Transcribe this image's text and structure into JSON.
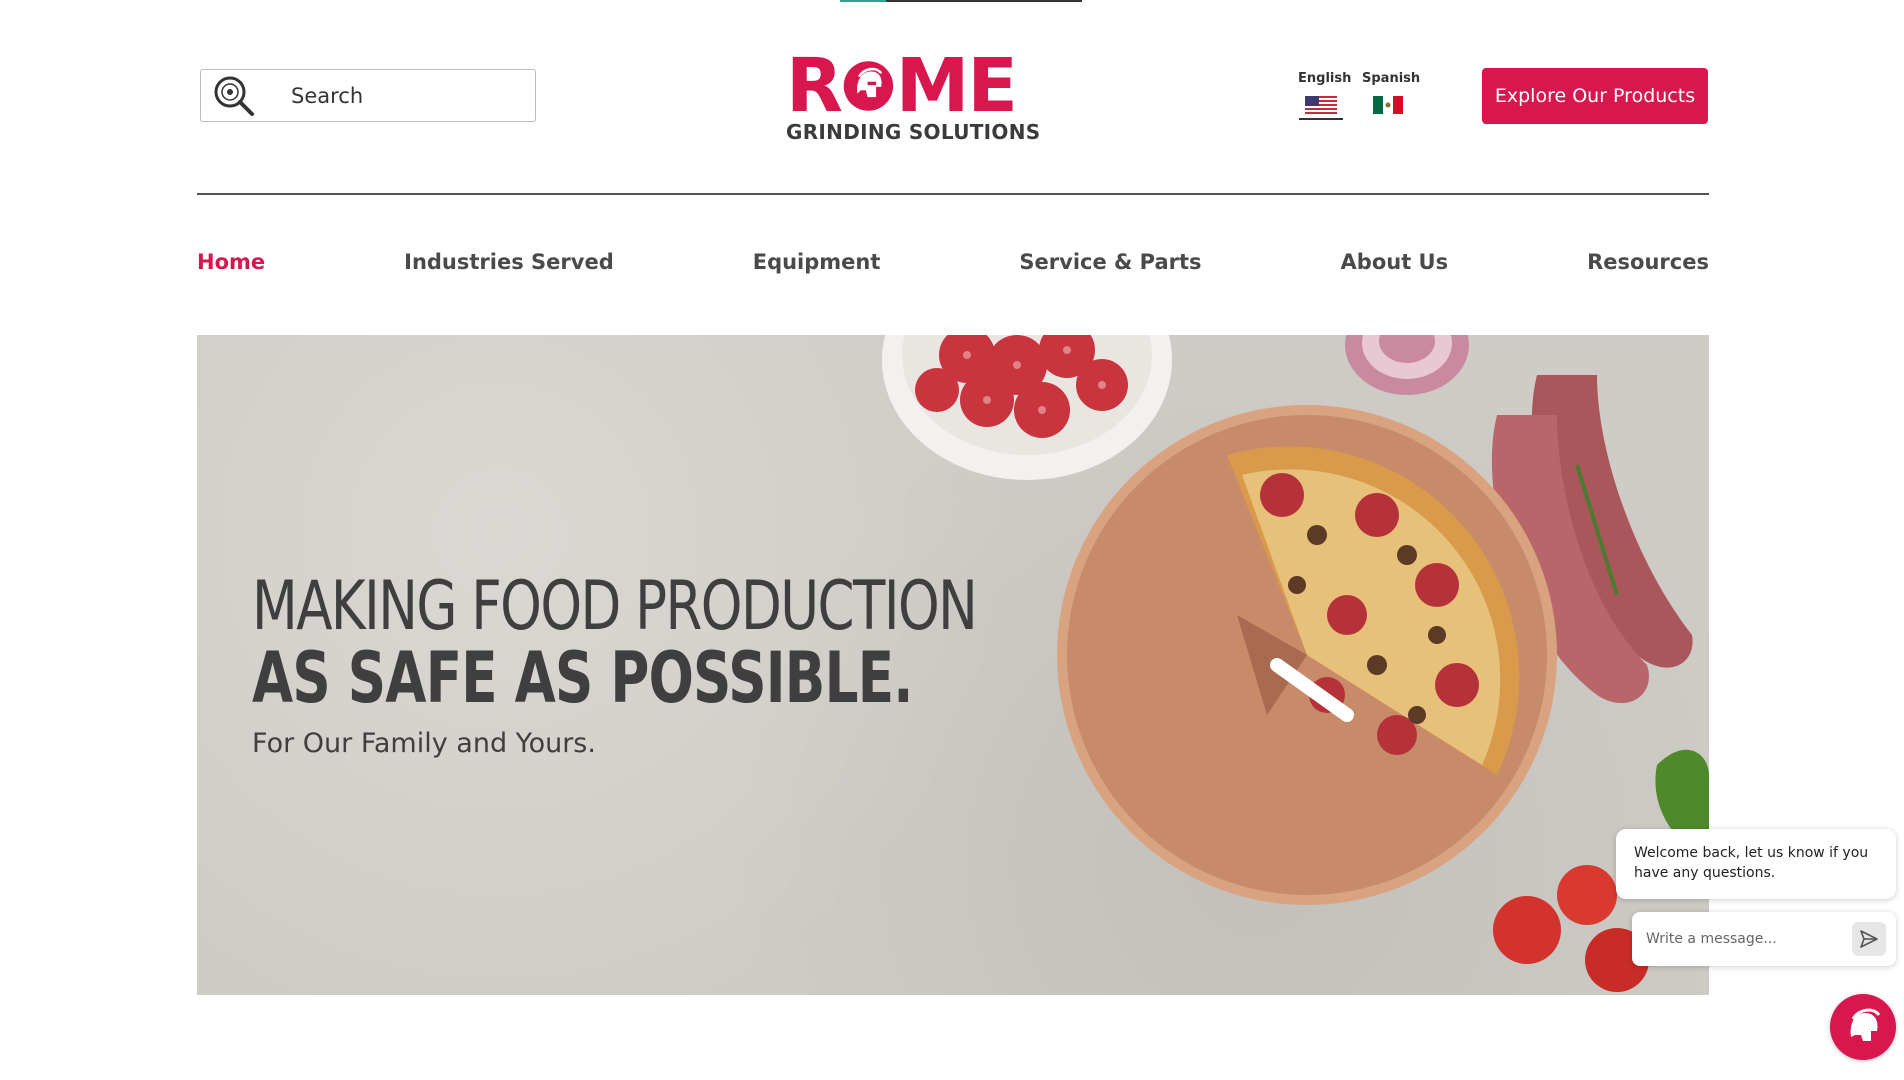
{
  "header": {
    "search_placeholder": "Search",
    "logo": {
      "brand": "ROME",
      "subtitle": "GRINDING SOLUTIONS"
    },
    "languages": [
      {
        "label": "English",
        "flag_icon": "us-flag-icon",
        "active": true
      },
      {
        "label": "Spanish",
        "flag_icon": "mexico-flag-icon",
        "active": false
      }
    ],
    "cta_label": "Explore Our Products"
  },
  "nav": {
    "items": [
      {
        "label": "Home",
        "active": true
      },
      {
        "label": "Industries Served"
      },
      {
        "label": "Equipment"
      },
      {
        "label": "Service & Parts"
      },
      {
        "label": "About Us"
      },
      {
        "label": "Resources"
      }
    ]
  },
  "hero": {
    "headline_line1": "MAKING FOOD PRODUCTION",
    "headline_line2": "AS SAFE AS POSSIBLE.",
    "tagline": "For Our Family and Yours."
  },
  "chat": {
    "message": "Welcome back, let us know if you have any questions.",
    "input_placeholder": "Write a message...",
    "send_icon": "send-icon",
    "launcher_icon": "spartan-helmet-icon"
  },
  "colors": {
    "brand_red": "#d8174f",
    "text_dark": "#3f3f3f",
    "hero_bg": "#cfcbc6"
  }
}
